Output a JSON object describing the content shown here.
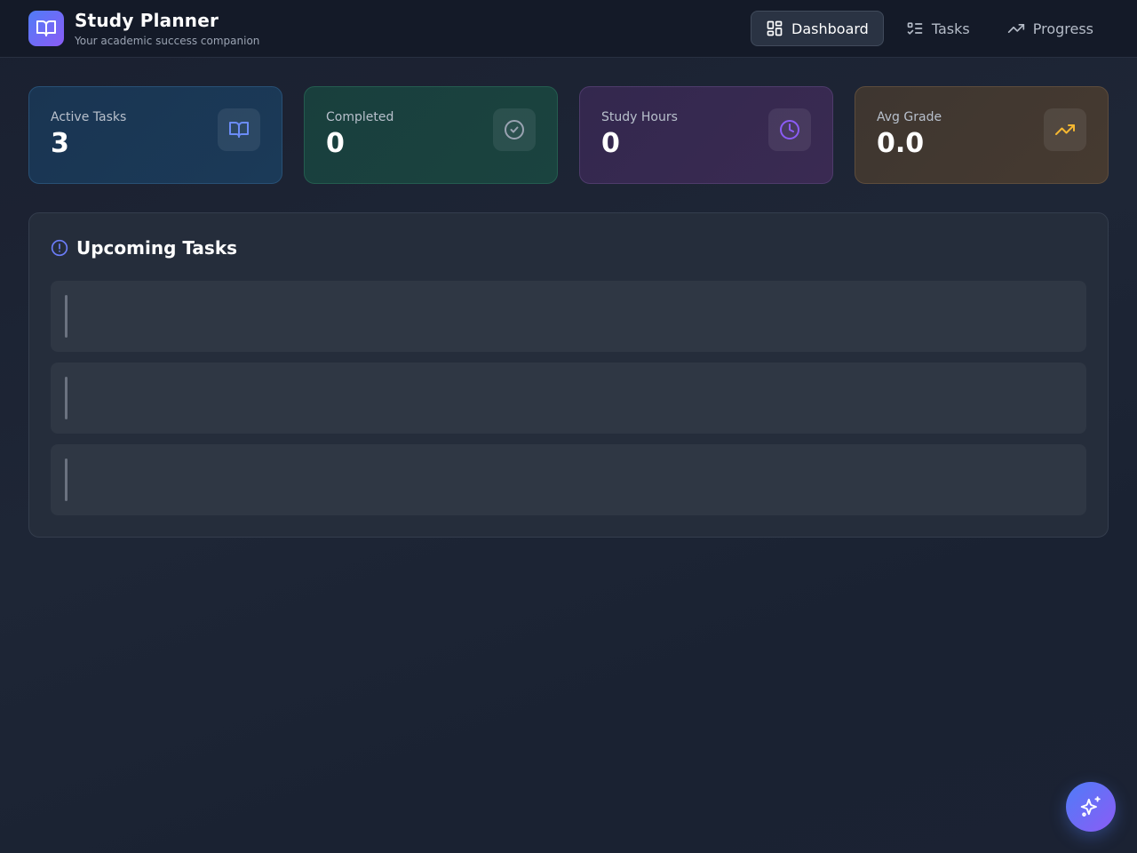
{
  "app": {
    "title": "Study Planner",
    "subtitle": "Your academic success companion"
  },
  "nav": {
    "items": [
      {
        "label": "Dashboard",
        "icon": "dashboard-grid-icon",
        "active": true
      },
      {
        "label": "Tasks",
        "icon": "task-list-icon",
        "active": false
      },
      {
        "label": "Progress",
        "icon": "trending-up-icon",
        "active": false
      }
    ]
  },
  "stats": [
    {
      "label": "Active Tasks",
      "value": "3",
      "icon": "book-open-icon",
      "color": "#6b8cf7"
    },
    {
      "label": "Completed",
      "value": "0",
      "icon": "check-circle-icon",
      "color": "#9aa3b2"
    },
    {
      "label": "Study Hours",
      "value": "0",
      "icon": "clock-icon",
      "color": "#8b5cf6"
    },
    {
      "label": "Avg Grade",
      "value": "0.0",
      "icon": "trending-up-icon",
      "color": "#f5b731"
    }
  ],
  "upcoming": {
    "title": "Upcoming Tasks",
    "icon": "alert-circle-icon",
    "accent": "#6b7cf7",
    "task_count": 3
  },
  "fab": {
    "icon": "sparkles-icon"
  },
  "colors": {
    "brand_gradient_start": "#4f7cf7",
    "brand_gradient_end": "#8b5cf6"
  }
}
